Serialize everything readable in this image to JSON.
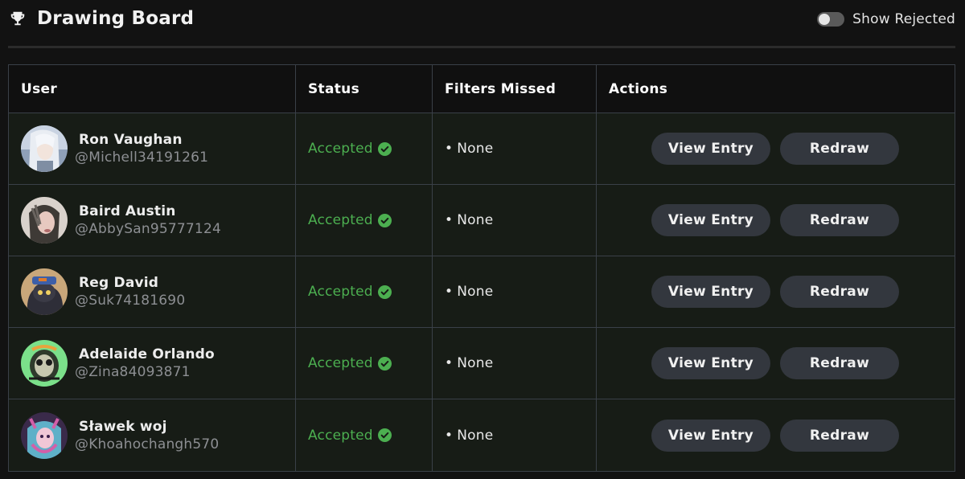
{
  "header": {
    "title": "Drawing Board",
    "icon": "trophy-icon",
    "toggle": {
      "label": "Show Rejected",
      "on": false
    }
  },
  "table": {
    "columns": [
      "User",
      "Status",
      "Filters Missed",
      "Actions"
    ],
    "rows": [
      {
        "name": "Ron Vaughan",
        "handle": "@Michell34191261",
        "status": "Accepted",
        "filters": "None",
        "view_label": "View Entry",
        "redraw_label": "Redraw"
      },
      {
        "name": "Baird Austin",
        "handle": "@AbbySan95777124",
        "status": "Accepted",
        "filters": "None",
        "view_label": "View Entry",
        "redraw_label": "Redraw"
      },
      {
        "name": "Reg David",
        "handle": "@Suk74181690",
        "status": "Accepted",
        "filters": "None",
        "view_label": "View Entry",
        "redraw_label": "Redraw"
      },
      {
        "name": "Adelaide Orlando",
        "handle": "@Zina84093871",
        "status": "Accepted",
        "filters": "None",
        "view_label": "View Entry",
        "redraw_label": "Redraw"
      },
      {
        "name": "Sławek woj",
        "handle": "@Khoahochangh570",
        "status": "Accepted",
        "filters": "None",
        "view_label": "View Entry",
        "redraw_label": "Redraw"
      }
    ]
  },
  "colors": {
    "accepted": "#4caf50",
    "button_bg": "#33373e",
    "row_bg": "#171c16",
    "border": "#3a4048"
  }
}
